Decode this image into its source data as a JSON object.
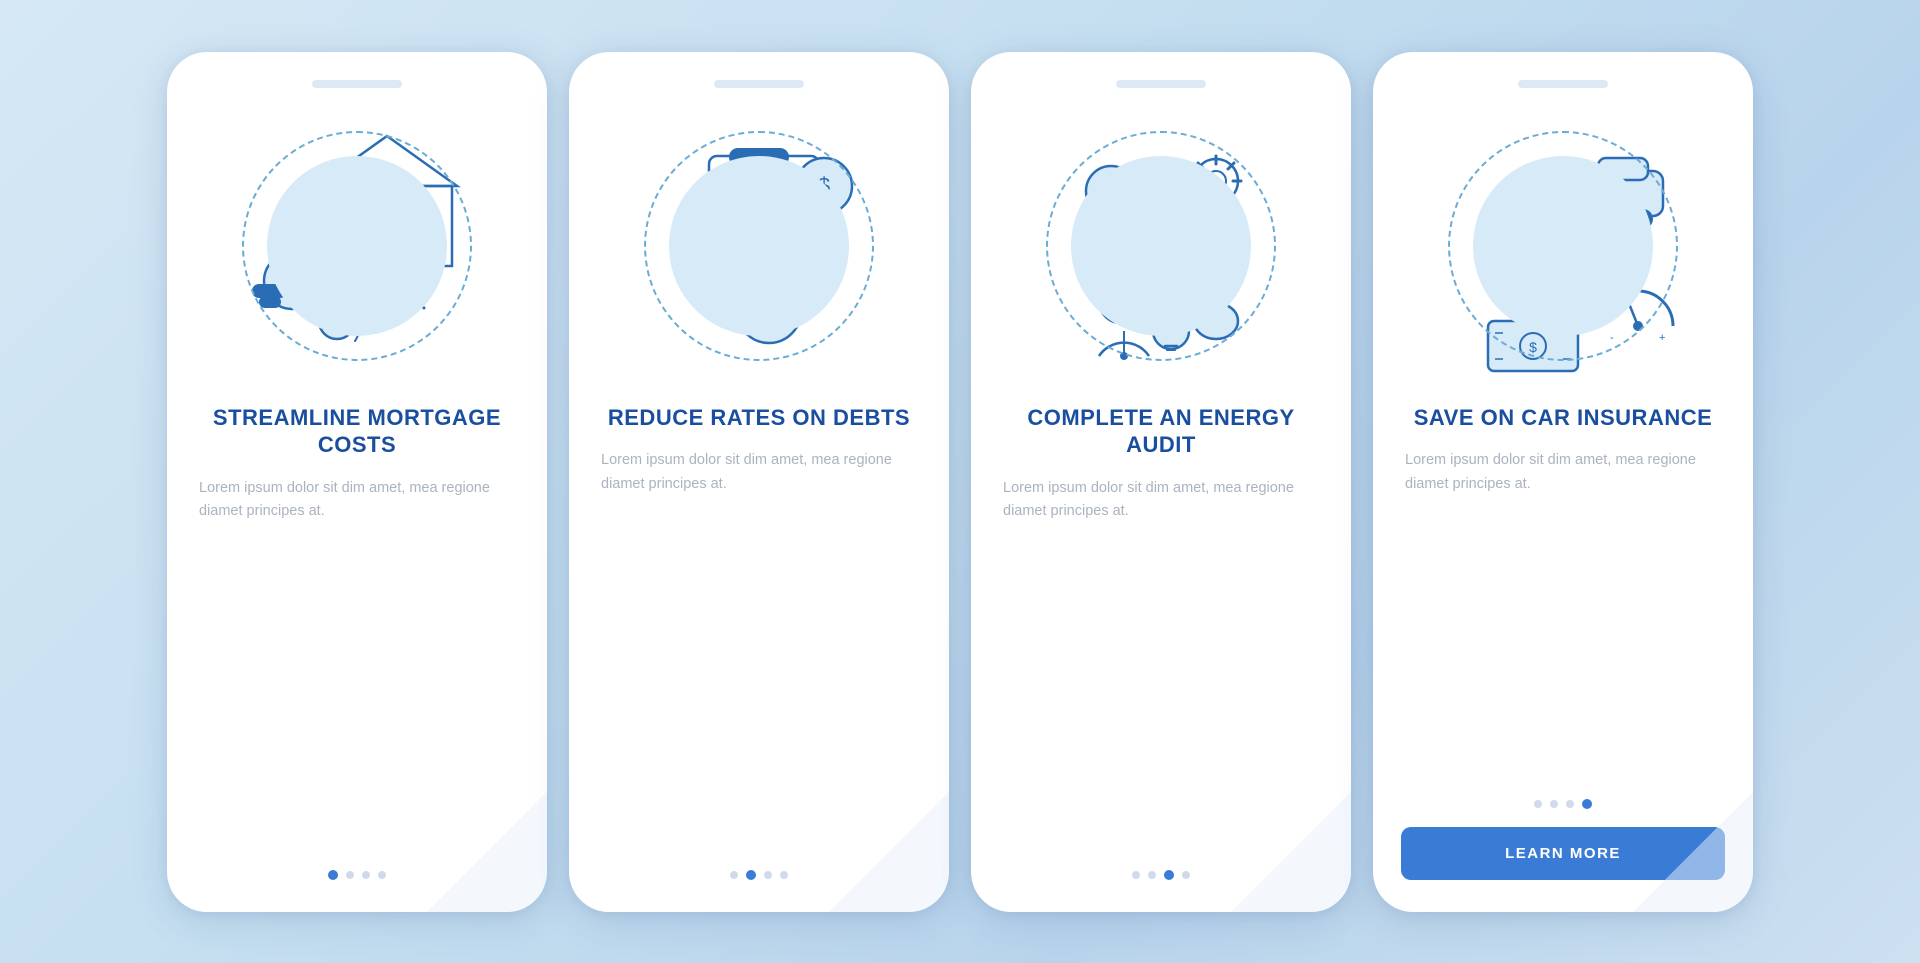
{
  "background": "#c8dff0",
  "phones": [
    {
      "id": "phone-1",
      "title": "STREAMLINE\nMORTGAGE COSTS",
      "description": "Lorem ipsum dolor sit dim amet, mea regione diamet principes at.",
      "dots": [
        true,
        false,
        false,
        false
      ],
      "hasButton": false,
      "activeDotsIndex": 0
    },
    {
      "id": "phone-2",
      "title": "REDUCE RATES\nON DEBTS",
      "description": "Lorem ipsum dolor sit dim amet, mea regione diamet principes at.",
      "dots": [
        false,
        true,
        false,
        false
      ],
      "hasButton": false,
      "activeDotsIndex": 1
    },
    {
      "id": "phone-3",
      "title": "COMPLETE AN\nENERGY AUDIT",
      "description": "Lorem ipsum dolor sit dim amet, mea regione diamet principes at.",
      "dots": [
        false,
        false,
        true,
        false
      ],
      "hasButton": false,
      "activeDotsIndex": 2
    },
    {
      "id": "phone-4",
      "title": "SAVE ON\nCAR INSURANCE",
      "description": "Lorem ipsum dolor sit dim amet, mea regione diamet principes at.",
      "dots": [
        false,
        false,
        false,
        true
      ],
      "hasButton": true,
      "buttonLabel": "LEARN MORE",
      "activeDotsIndex": 3
    }
  ]
}
